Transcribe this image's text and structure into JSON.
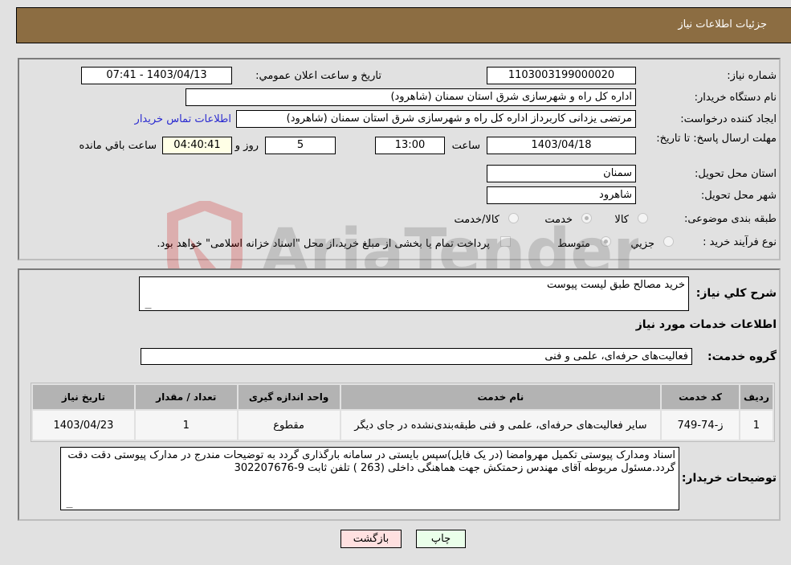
{
  "header": {
    "title": "جزئیات اطلاعات نیاز"
  },
  "details": {
    "need_number_label": "شماره نیاز:",
    "need_number": "1103003199000020",
    "announce_label": "تاریخ و ساعت اعلان عمومي:",
    "announce_value": "1403/04/13 - 07:41",
    "buyer_org_label": "نام دستگاه خریدار:",
    "buyer_org": "اداره کل راه و شهرسازی شرق استان سمنان (شاهرود)",
    "creator_label": "ایجاد کننده درخواست:",
    "creator": "مرتضی یزدانی کاربرداز اداره کل راه و شهرسازی شرق استان سمنان (شاهرود)",
    "contact_link": "اطلاعات تماس خریدار",
    "deadline_label": "مهلت ارسال پاسخ: تا تاریخ:",
    "deadline_date": "1403/04/18",
    "time_label": "ساعت",
    "deadline_time": "13:00",
    "days_value": "5",
    "days_label": "روز و",
    "remaining_value": "04:40:41",
    "remaining_label": "ساعت باقي مانده",
    "province_label": "استان محل تحویل:",
    "province": "سمنان",
    "city_label": "شهر محل تحویل:",
    "city": "شاهرود",
    "category_label": "طبقه بندی موضوعی:",
    "category_options": [
      {
        "label": "کالا",
        "checked": false
      },
      {
        "label": "خدمت",
        "checked": true
      },
      {
        "label": "کالا/خدمت",
        "checked": false
      }
    ],
    "process_label": "نوع فرآیند خرید :",
    "process_options": [
      {
        "label": "جزيي",
        "checked": false
      },
      {
        "label": "متوسط",
        "checked": true
      }
    ],
    "treasury_text": "پرداخت تمام یا بخشی از مبلغ خرید،از محل \"اسناد خزانه اسلامی\" خواهد بود."
  },
  "description": {
    "label": "شرح کلي نياز:",
    "value": "خرید مصالح  طبق لیست پیوست"
  },
  "services": {
    "section_title": "اطلاعات خدمات مورد نياز",
    "group_label": "گروه خدمت:",
    "group_value": "فعالیت‌های حرفه‌ای، علمی و فنی",
    "table": {
      "headers": [
        "ردیف",
        "کد خدمت",
        "نام خدمت",
        "واحد اندازه گیری",
        "تعداد / مقدار",
        "تاریخ نیاز"
      ],
      "rows": [
        [
          "1",
          "ز-74-749",
          "سایر فعالیت‌های حرفه‌ای، علمی و فنی طبقه‌بندی‌نشده در جای دیگر",
          "مقطوع",
          "1",
          "1403/04/23"
        ]
      ]
    }
  },
  "buyer_notes": {
    "label": "توضیحات خریدار:",
    "value": "اسناد ومدارک پیوستی تکمیل مهروامضا (در یک فایل)سپس بایستی در سامانه بارگذاری گردد به توضیحات مندرج در مدارک پیوستی دقت  دقت گردد.مسئول مربوطه آقای مهندس زحمتکش جهت هماهنگی داخلی  (263 )    تلفن ثابت   9-302207676"
  },
  "buttons": {
    "print": "چاپ",
    "back": "بازگشت"
  },
  "watermark": {
    "text": "AriaTender.neT"
  }
}
